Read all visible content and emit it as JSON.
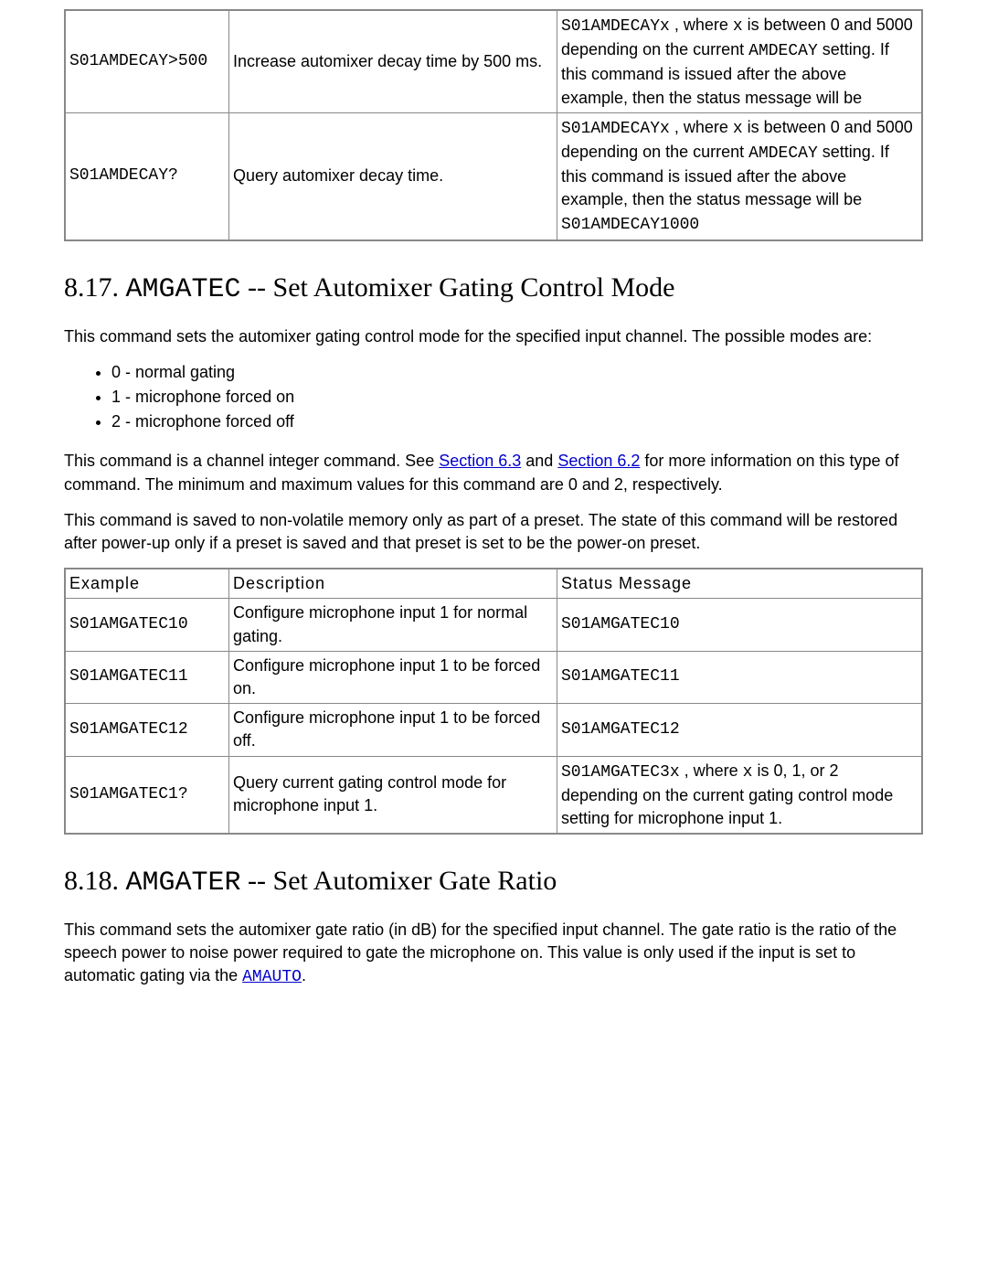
{
  "table0": {
    "rows": [
      {
        "example": "S01AMDECAY>500",
        "description": "Increase automixer decay time by 500 ms.",
        "status_prefix_code": "S01AMDECAYx",
        "status_mid1": " , where ",
        "status_var": "x",
        "status_mid2": " is between 0 and 5000 depending on the current ",
        "status_code2": "AMDECAY",
        "status_tail": " setting. If this command is issued after the above example, then the status message will be"
      },
      {
        "example": "S01AMDECAY?",
        "description": "Query automixer decay time.",
        "status_prefix_code": "S01AMDECAYx",
        "status_mid1": " , where ",
        "status_var": "x",
        "status_mid2": " is between 0 and 5000 depending on the current ",
        "status_code2": "AMDECAY",
        "status_tail": " setting. If this command is issued after the above example, then the status message will be ",
        "status_tail_code": "S01AMDECAY1000"
      }
    ]
  },
  "section17": {
    "num": "8.17. ",
    "cmd": "AMGATEC",
    "title_rest": " -- Set Automixer Gating Control Mode",
    "intro": "This command sets the automixer gating control mode for the specified input channel. The possible modes are:",
    "modes": [
      "0 - normal gating",
      "1 - microphone forced on",
      "2 - microphone forced off"
    ],
    "para2_a": "This command is a channel integer command. See ",
    "link63": "Section 6.3",
    "para2_b": " and ",
    "link62": "Section 6.2",
    "para2_c": " for more information on this type of command. The minimum and maximum values for this command are 0 and 2, respectively.",
    "para3": "This command is saved to non-volatile memory only as part of a preset. The state of this command will be restored after power-up only if a preset is saved and that preset is set to be the power-on preset.",
    "th_example": "Example",
    "th_desc": "Description",
    "th_status": "Status Message",
    "rows": [
      {
        "example": "S01AMGATEC10",
        "description": "Configure microphone input 1 for normal gating.",
        "status_code": "S01AMGATEC10"
      },
      {
        "example": "S01AMGATEC11",
        "description": "Configure microphone input 1 to be forced on.",
        "status_code": "S01AMGATEC11"
      },
      {
        "example": "S01AMGATEC12",
        "description": "Configure microphone input 1 to be forced off.",
        "status_code": "S01AMGATEC12"
      },
      {
        "example": "S01AMGATEC1?",
        "description": "Query current gating control mode for microphone input 1.",
        "status_code": "S01AMGATEC3x",
        "status_mid1": " , where ",
        "status_var": "x",
        "status_tail": " is 0, 1, or 2 depending on the current gating control mode setting for microphone input 1."
      }
    ]
  },
  "section18": {
    "num": "8.18. ",
    "cmd": "AMGATER",
    "title_rest": " -- Set Automixer Gate Ratio",
    "para1_a": "This command sets the automixer gate ratio (in dB) for the specified input channel. The gate ratio is the ratio of the speech power to noise power required to gate the microphone on. This value is only used if the input is set to automatic gating via the ",
    "link_amauto": "AMAUTO",
    "para1_b": "."
  }
}
